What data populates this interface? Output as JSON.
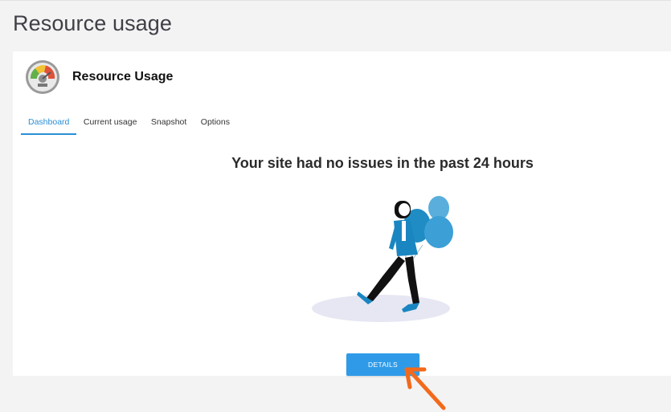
{
  "page": {
    "title": "Resource usage"
  },
  "card": {
    "title": "Resource Usage",
    "logo_icon": "gauge-icon"
  },
  "tabs": [
    {
      "label": "Dashboard",
      "active": true
    },
    {
      "label": "Current usage",
      "active": false
    },
    {
      "label": "Snapshot",
      "active": false
    },
    {
      "label": "Options",
      "active": false
    }
  ],
  "dashboard": {
    "headline": "Your site had no issues in the past 24 hours",
    "illustration": "woman-with-balloons-illustration",
    "details_label": "DETAILS"
  },
  "annotation": {
    "arrow_icon": "arrow-pointer-icon",
    "color": "#f26a1b"
  },
  "colors": {
    "accent": "#2a8fd6",
    "button": "#2f9be8",
    "balloon": "#1f8cc4"
  }
}
